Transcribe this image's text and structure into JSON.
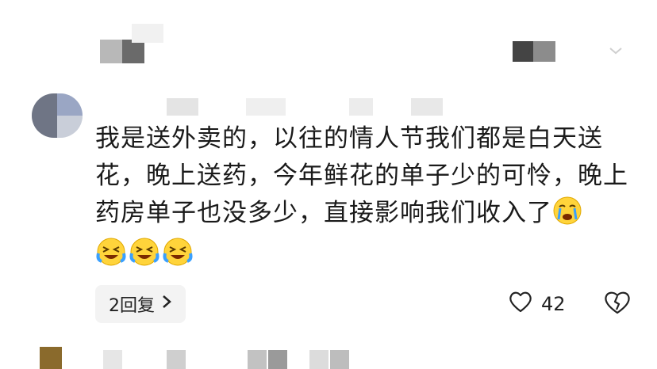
{
  "comment": {
    "text": "我是送外卖的，以往的情人节我们都是白天送花，晚上送药，今年鲜花的单子少的可怜，晚上药房单子也没多少，直接影响我们收入了",
    "inline_emoji": "crying-face",
    "trailing_emojis": [
      "laughing-crying-face",
      "laughing-crying-face",
      "laughing-crying-face"
    ]
  },
  "actions": {
    "reply_label": "2回复",
    "like_count": "42"
  },
  "colors": {
    "text": "#1a1a1a",
    "reply_bg": "#f3f3f3",
    "pixel_gray_dark": "#5a5a5a",
    "pixel_gray_light": "#b5b5b5"
  }
}
